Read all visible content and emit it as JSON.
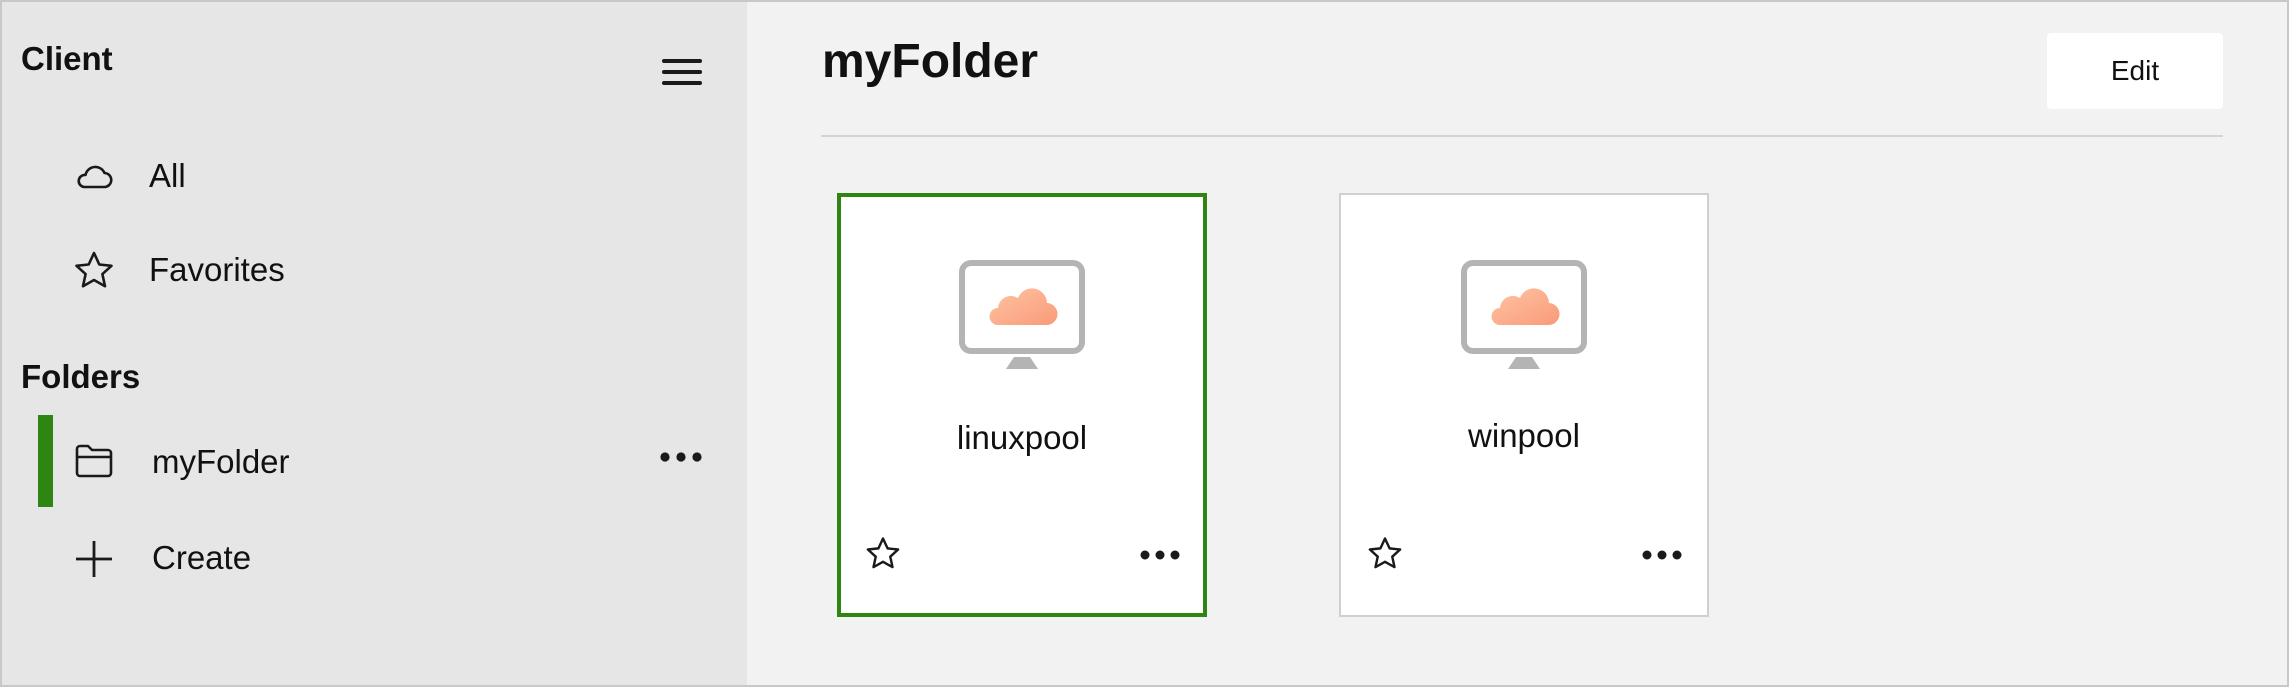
{
  "sidebar": {
    "title": "Client",
    "nav": [
      {
        "label": "All",
        "icon": "cloud-icon"
      },
      {
        "label": "Favorites",
        "icon": "star-icon"
      }
    ],
    "folders_heading": "Folders",
    "folders": [
      {
        "label": "myFolder",
        "icon": "folder-icon",
        "selected": true
      }
    ],
    "create_label": "Create"
  },
  "main": {
    "title": "myFolder",
    "edit_label": "Edit",
    "desktops": [
      {
        "name": "linuxpool",
        "icon": "desktop-cloud-icon",
        "selected": true
      },
      {
        "name": "winpool",
        "icon": "desktop-cloud-icon",
        "selected": false
      }
    ]
  },
  "colors": {
    "accent": "#2e8511",
    "sidebar_bg": "#e6e6e6",
    "main_bg": "#f2f2f2",
    "cloud_light": "#ffc4a4",
    "cloud_dark": "#f99a78",
    "monitor_gray": "#b4b4b4"
  }
}
